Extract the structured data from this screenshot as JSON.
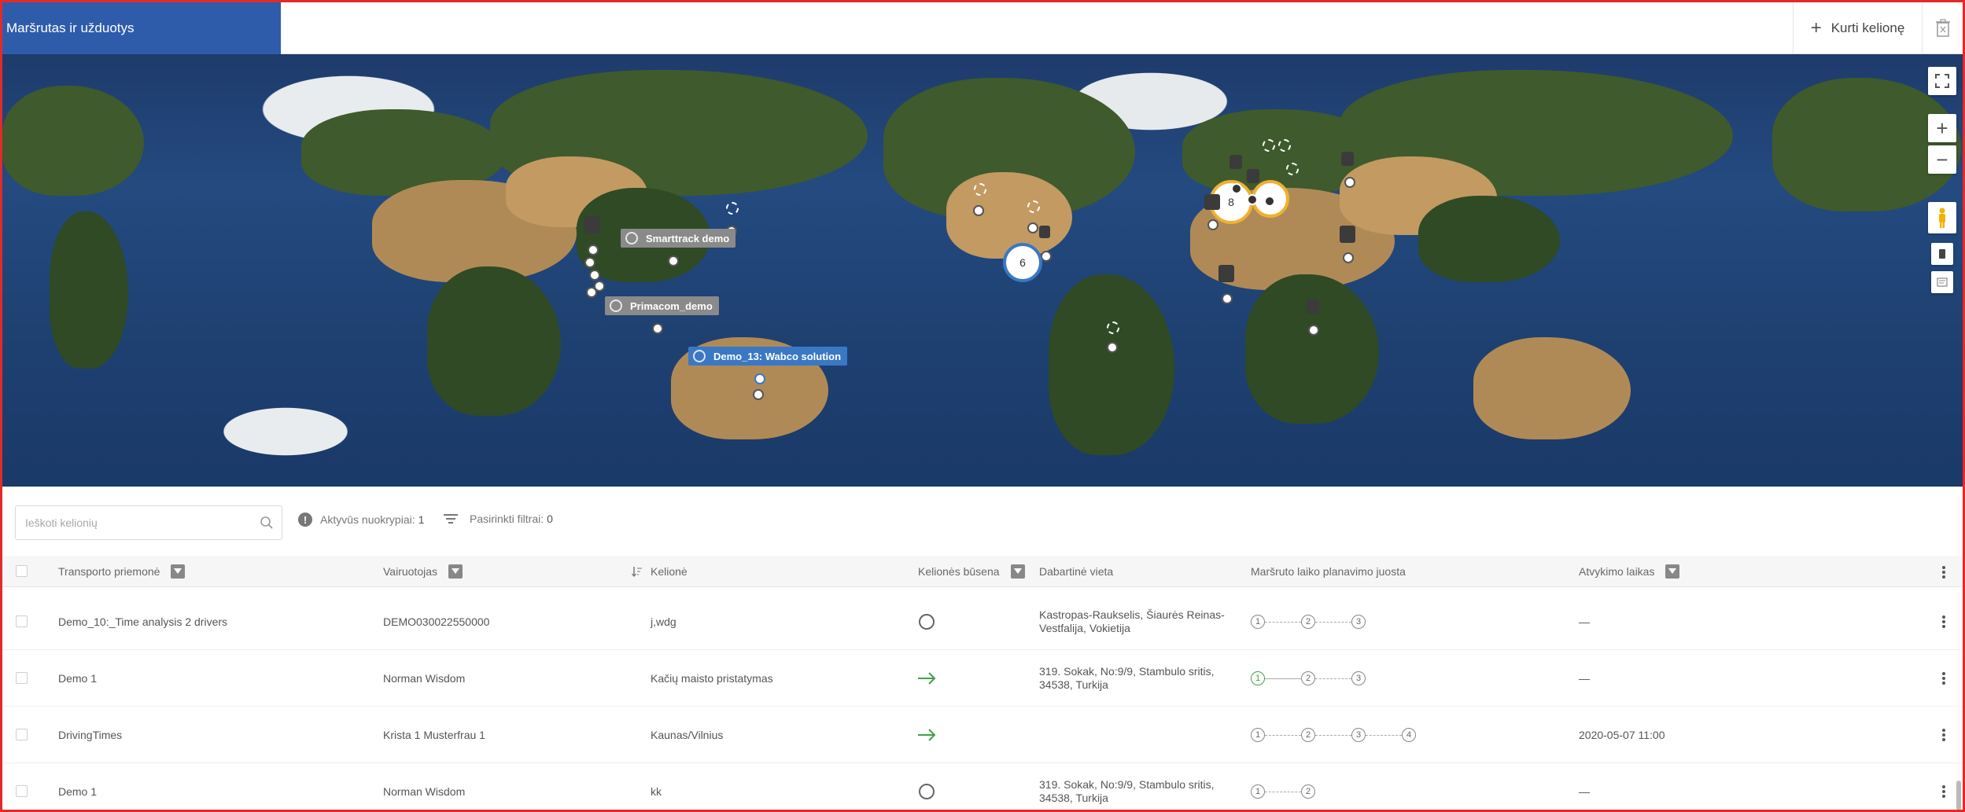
{
  "header": {
    "title": "Maršrutas ir užduotys",
    "create_label": "Kurti kelionę"
  },
  "map": {
    "labels": {
      "smarttrack": "Smarttrack demo",
      "primacom": "Primacom_demo",
      "demo13": "Demo_13: Wabco solution"
    },
    "clusters": {
      "americas": "6",
      "europe": "8"
    }
  },
  "toolbar": {
    "search_placeholder": "Ieškoti kelionių",
    "active_label": "Aktyvūs nuokrypiai:",
    "active_count": "1",
    "filters_label": "Pasirinkti filtrai:",
    "filters_count": "0"
  },
  "table": {
    "headers": {
      "vehicle": "Transporto priemonė",
      "driver": "Vairuotojas",
      "trip": "Kelionė",
      "status": "Kelionės būsena",
      "location": "Dabartinė vieta",
      "timeline": "Maršruto laiko planavimo juosta",
      "eta": "Atvykimo laikas"
    },
    "rows": [
      {
        "vehicle": "Demo_10:_Time analysis 2 drivers",
        "driver": "DEMO030022550000",
        "trip": "j,wdg",
        "location1": "Kastropas-Raukselis, Šiaurės Reinas-",
        "location2": "Vestfalija, Vokietija",
        "eta": "—",
        "s1": "1",
        "s2": "2",
        "s3": "3"
      },
      {
        "vehicle": "Demo 1",
        "driver": "Norman Wisdom",
        "trip": "Kačių maisto pristatymas",
        "location1": "319. Sokak, No:9/9, Stambulo sritis,",
        "location2": "34538, Turkija",
        "eta": "—",
        "s1": "1",
        "s2": "2",
        "s3": "3"
      },
      {
        "vehicle": "DrivingTimes",
        "driver": "Krista 1 Musterfrau 1",
        "trip": "Kaunas/Vilnius",
        "location1": "",
        "location2": "",
        "eta": "2020-05-07 11:00",
        "s1": "1",
        "s2": "2",
        "s3": "3",
        "s4": "4"
      },
      {
        "vehicle": "Demo 1",
        "driver": "Norman Wisdom",
        "trip": "kk",
        "location1": "319. Sokak, No:9/9, Stambulo sritis,",
        "location2": "34538, Turkija",
        "eta": "—",
        "s1": "1",
        "s2": "2"
      }
    ]
  },
  "colors": {
    "brand": "#2f5caa",
    "border": "#e32a2a",
    "active_green": "#43a047"
  }
}
